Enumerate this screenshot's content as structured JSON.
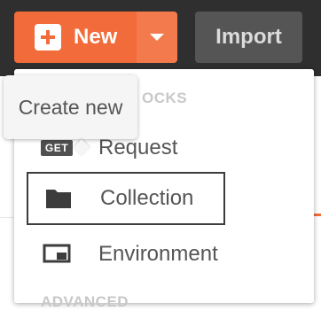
{
  "toolbar": {
    "new_label": "New",
    "import_label": "Import"
  },
  "colors": {
    "accent": "#f26b3a",
    "topbar": "#2f2f2f"
  },
  "tooltip": {
    "text": "Create new"
  },
  "menu": {
    "building_blocks_header": "BUILDING BLOCKS",
    "building_blocks_header_visible": "OCKS",
    "items": [
      {
        "label": "Request",
        "icon": "get-badge-icon",
        "badge": "GET",
        "selected": false
      },
      {
        "label": "Collection",
        "icon": "folder-icon",
        "selected": true
      },
      {
        "label": "Environment",
        "icon": "environment-icon",
        "selected": false
      }
    ],
    "advanced_header": "ADVANCED"
  }
}
